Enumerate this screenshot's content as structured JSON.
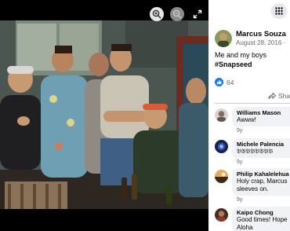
{
  "viewer": {
    "zoom_in_icon": "zoom-in-icon",
    "zoom_out_icon": "zoom-out-icon",
    "fullscreen_icon": "fullscreen-icon"
  },
  "panel": {
    "menu_icon": "grid-menu-icon",
    "author": {
      "name": "Marcus Souza",
      "date": "August 28, 2016 · "
    },
    "caption": {
      "text": "Me and my boys",
      "hashtag": "#Snapseed"
    },
    "likes": {
      "count": "64"
    },
    "share": {
      "label": "Sha"
    },
    "comments": [
      {
        "name": "Williams Mason",
        "text": [
          "Awww!"
        ],
        "age": "9y"
      },
      {
        "name": "Michele Palencia",
        "text": [
          "𝔅𝔅𝔅𝔅𝔅𝔅𝔅𝔅"
        ],
        "age": "9y"
      },
      {
        "name": "Philip Kahalelehua",
        "text": [
          "Holy crap, Marcus",
          "sleeves on."
        ],
        "age": "9y"
      },
      {
        "name": "Kaipo Chong",
        "text": [
          "Good times! Hope",
          "Aloha"
        ],
        "age": ""
      }
    ]
  },
  "colors": {
    "facebook_blue": "#1877f2",
    "comment_bubble": "#f0f2f5",
    "secondary_text": "#65676b"
  }
}
